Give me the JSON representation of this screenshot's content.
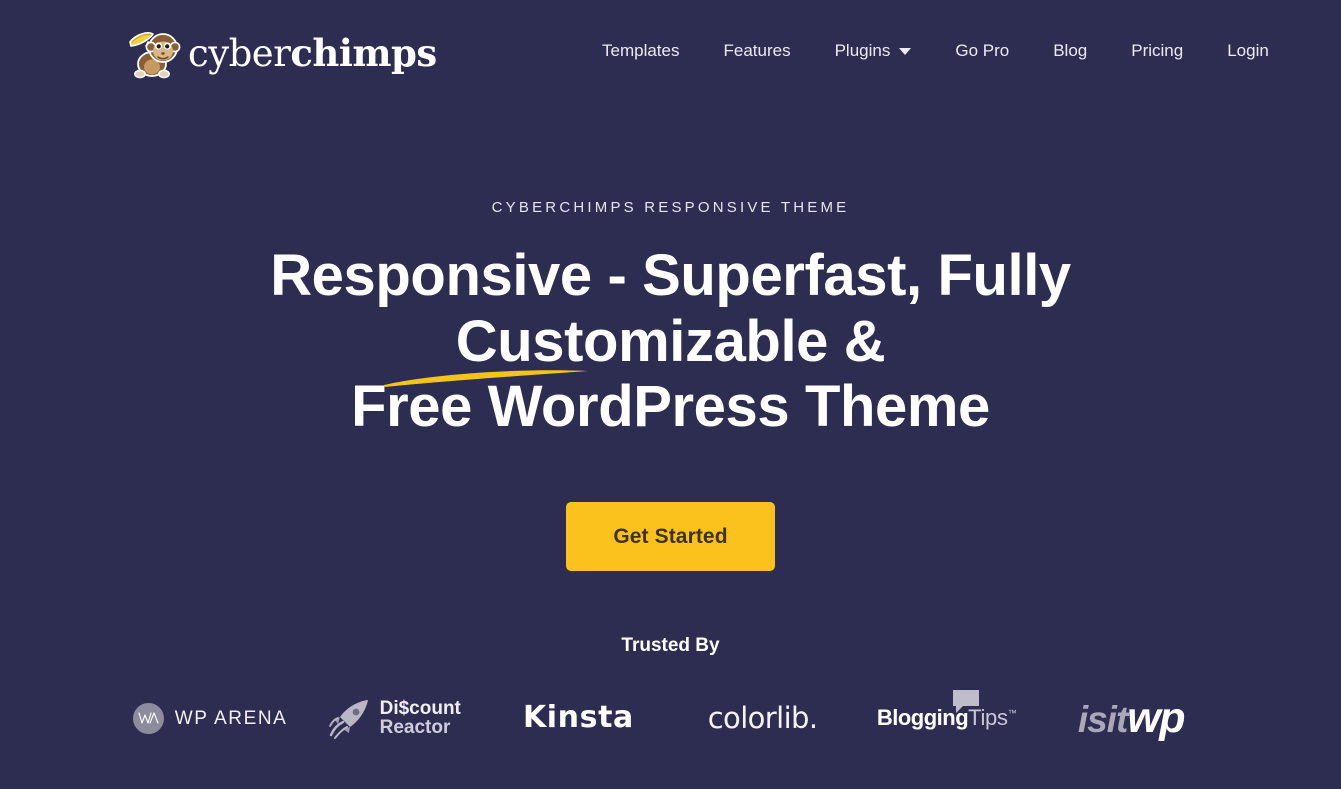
{
  "theme": {
    "background": "#2d2d52",
    "accent": "#fbc11c",
    "text_light": "#ffffff",
    "text_muted": "#c9c7d4"
  },
  "header": {
    "brand": {
      "name_light": "cyber",
      "name_bold": "chimps",
      "logo_icon": "monkey-with-banana-icon"
    },
    "nav": [
      {
        "label": "Templates",
        "has_dropdown": false
      },
      {
        "label": "Features",
        "has_dropdown": false
      },
      {
        "label": "Plugins",
        "has_dropdown": true
      },
      {
        "label": "Go Pro",
        "has_dropdown": false
      },
      {
        "label": "Blog",
        "has_dropdown": false
      },
      {
        "label": "Pricing",
        "has_dropdown": false
      },
      {
        "label": "Login",
        "has_dropdown": false
      }
    ]
  },
  "hero": {
    "eyebrow": "CYBERCHIMPS RESPONSIVE THEME",
    "headline_line1": "Responsive - Superfast, Fully Customizable &",
    "headline_line2": "Free WordPress Theme",
    "underline_icon": "yellow-brush-stroke-icon",
    "cta_label": "Get Started"
  },
  "trusted": {
    "title": "Trusted By",
    "logos": [
      {
        "name": "WP ARENA",
        "badge_text": "WA",
        "icon": "wp-arena-circle-badge-icon"
      },
      {
        "line1": "Di$count",
        "line2": "Reactor",
        "icon": "rocket-icon"
      },
      {
        "name": "Kinsta"
      },
      {
        "name": "colorlib."
      },
      {
        "part_bold": "Blogging",
        "part_light": "Tips",
        "trademark": "™",
        "icon": "speech-bubble-icon"
      },
      {
        "part_gray": "isit",
        "part_white": "wp"
      }
    ]
  }
}
